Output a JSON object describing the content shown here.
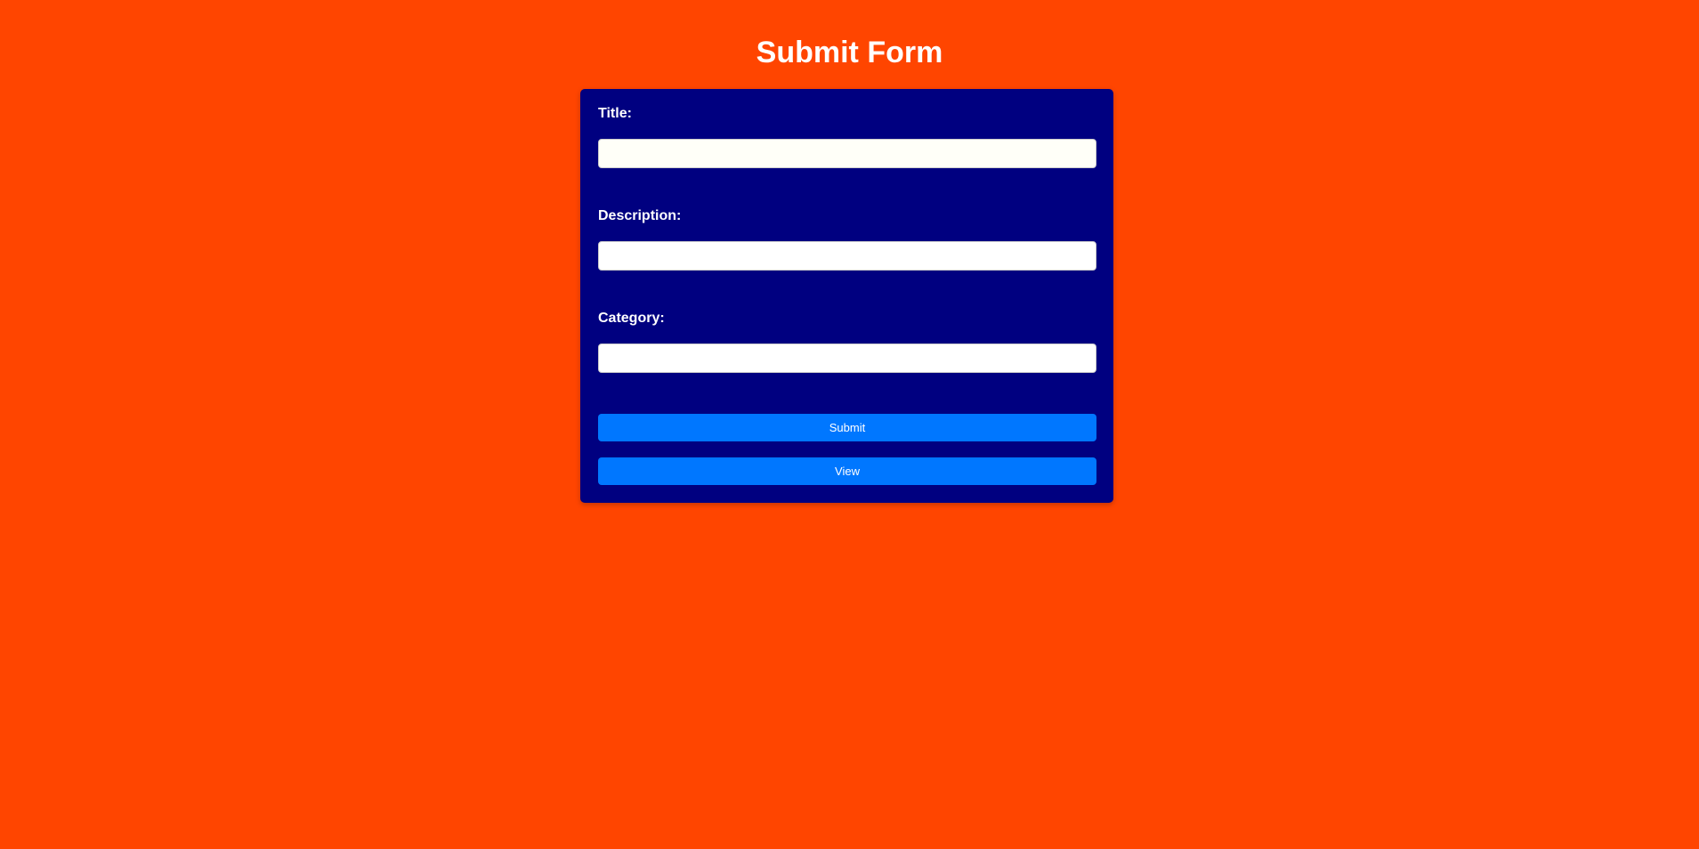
{
  "page": {
    "title": "Submit Form"
  },
  "form": {
    "fields": [
      {
        "label": "Title:",
        "value": "",
        "placeholder": ""
      },
      {
        "label": "Description:",
        "value": "",
        "placeholder": ""
      },
      {
        "label": "Category:",
        "value": "",
        "placeholder": ""
      }
    ],
    "submit_label": "Submit",
    "view_label": "View"
  },
  "colors": {
    "background": "#FF4500",
    "card": "#000080",
    "button": "#0077FF",
    "text": "#FFFFFF"
  }
}
